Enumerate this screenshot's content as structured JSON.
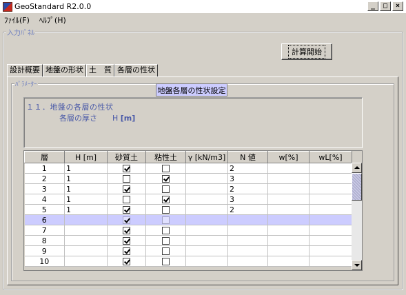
{
  "window": {
    "title": "GeoStandard R2.0.0",
    "controls": [
      "_",
      "□",
      "×"
    ]
  },
  "menu": {
    "items": [
      "ﾌｧｲﾙ(F)",
      "ﾍﾙﾌﾟ(H)"
    ]
  },
  "input_panel": {
    "label": "入力ﾊﾟﾈﾙ"
  },
  "toolbar": {
    "calc_label": "計算開始"
  },
  "tabs": [
    {
      "label": "設計概要"
    },
    {
      "label": "地盤の形状"
    },
    {
      "label": "土　質"
    },
    {
      "label": "各層の性状",
      "active": true
    }
  ],
  "params": {
    "label": "ﾊﾟﾗﾒｰﾀｰ",
    "section_title": "地盤各層の性状設定",
    "desc_line1": "１１．地盤の各層の性状",
    "desc_line2_prefix": "各層の厚さ　　H ",
    "desc_line2_unit": "[m]"
  },
  "table": {
    "columns": [
      "層",
      "H [m]",
      "砂質土",
      "粘性土",
      "γ [kN/m3]",
      "N 値",
      "w[%]",
      "wL[%]"
    ],
    "selected_row": 5,
    "rows": [
      {
        "layer": "1",
        "h": "1",
        "sand": true,
        "clay": false,
        "gamma": "",
        "n": "2",
        "w": "",
        "wl": ""
      },
      {
        "layer": "2",
        "h": "1",
        "sand": false,
        "clay": true,
        "gamma": "",
        "n": "3",
        "w": "",
        "wl": ""
      },
      {
        "layer": "3",
        "h": "1",
        "sand": true,
        "clay": false,
        "gamma": "",
        "n": "2",
        "w": "",
        "wl": ""
      },
      {
        "layer": "4",
        "h": "1",
        "sand": false,
        "clay": true,
        "gamma": "",
        "n": "3",
        "w": "",
        "wl": ""
      },
      {
        "layer": "5",
        "h": "1",
        "sand": true,
        "clay": false,
        "gamma": "",
        "n": "2",
        "w": "",
        "wl": ""
      },
      {
        "layer": "6",
        "h": "",
        "sand": true,
        "clay": false,
        "gamma": "",
        "n": "",
        "w": "",
        "wl": ""
      },
      {
        "layer": "7",
        "h": "",
        "sand": true,
        "clay": false,
        "gamma": "",
        "n": "",
        "w": "",
        "wl": ""
      },
      {
        "layer": "8",
        "h": "",
        "sand": true,
        "clay": false,
        "gamma": "",
        "n": "",
        "w": "",
        "wl": ""
      },
      {
        "layer": "9",
        "h": "",
        "sand": true,
        "clay": false,
        "gamma": "",
        "n": "",
        "w": "",
        "wl": ""
      },
      {
        "layer": "10",
        "h": "",
        "sand": true,
        "clay": false,
        "gamma": "",
        "n": "",
        "w": "",
        "wl": ""
      }
    ]
  },
  "colors": {
    "selected_row": "#ccccff",
    "label_blue": "#4a5aa8",
    "section_title_bg": "#ccccff"
  },
  "icons": [
    "app-icon",
    "checkbox-icon",
    "scroll-up-icon",
    "scroll-down-icon"
  ]
}
